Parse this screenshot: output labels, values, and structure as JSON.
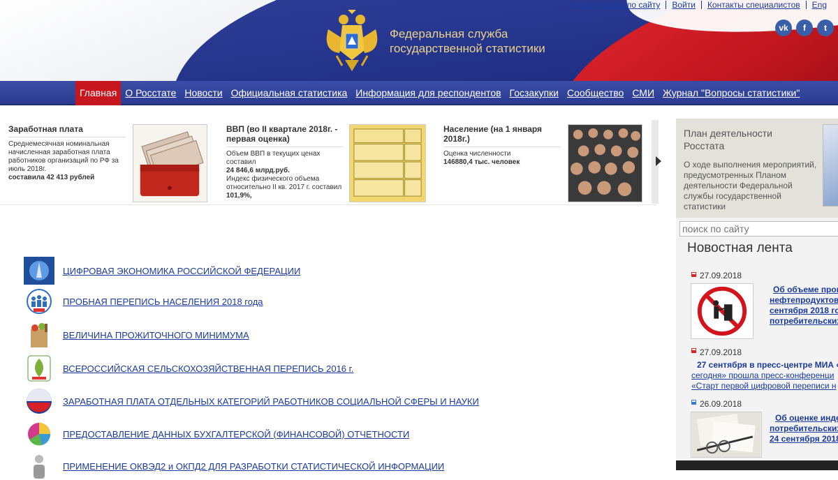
{
  "top_links": [
    "Путеводитель по сайту",
    "Войти",
    "Контакты специалистов",
    "Eng"
  ],
  "socials": [
    "vk",
    "f",
    "t"
  ],
  "logo": {
    "line1": "Федеральная служба",
    "line2": "государственной статистики"
  },
  "nav": [
    "Главная",
    "О Росстате",
    "Новости",
    "Официальная статистика",
    "Информация для респондентов",
    "Госзакупки",
    "Сообщество",
    "СМИ",
    "Журнал \"Вопросы статистики\""
  ],
  "slides": {
    "salary": {
      "title": "Заработная плата",
      "text": "Среднемесячная номинальная начисленная заработная плата работников организаций по РФ за июль 2018г.",
      "value": "составила 42 413 рублей"
    },
    "gdp": {
      "title": "ВВП (во II квартале 2018г. - первая оценка)",
      "text1": "Объем ВВП в текущих ценах составил",
      "value1": "24 846,6 млрд.руб.",
      "text2": "Индекс физического объема относительно II кв. 2017 г. составил",
      "value2": "101,9%,"
    },
    "population": {
      "title": "Население (на 1 января 2018г.)",
      "text": "Оценка численности",
      "value": "146880,4 тыс. человек"
    }
  },
  "plan": {
    "title": "План деятельности Росстата",
    "text": "О ходе выполнения мероприятий, предусмотренных Планом деятельности Федеральной службы государственной статистики"
  },
  "search": {
    "placeholder": "поиск по сайту"
  },
  "news": {
    "title": "Новостная лента",
    "items": [
      {
        "date": "27.09.2018",
        "lines": [
          "Об объеме прои",
          "нефтепродуктов",
          "сентября 2018 го",
          "потребительских"
        ]
      },
      {
        "date": "27.09.2018",
        "lines": [
          "27 сентября  в пресс-центре МИА «",
          "сегодня» прошла пресс-конференци",
          "«Старт первой цифровой переписи н"
        ]
      },
      {
        "date": "26.09.2018",
        "lines": [
          "Об оценке инде",
          "потребительских",
          "24 сентября 2018"
        ]
      }
    ]
  },
  "links": [
    "ЦИФРОВАЯ ЭКОНОМИКА РОССИЙСКОЙ ФЕДЕРАЦИИ",
    "ПРОБНАЯ ПЕРЕПИСЬ НАСЕЛЕНИЯ 2018 года",
    "ВЕЛИЧИНА ПРОЖИТОЧНОГО МИНИМУМА",
    "ВСЕРОССИЙСКАЯ СЕЛЬСКОХОЗЯЙСТВЕННАЯ ПЕРЕПИСЬ 2016 г.",
    "ЗАРАБОТНАЯ ПЛАТА ОТДЕЛЬНЫХ КАТЕГОРИЙ РАБОТНИКОВ СОЦИАЛЬНОЙ СФЕРЫ И НАУКИ",
    "ПРЕДОСТАВЛЕНИЕ ДАННЫХ БУХГАЛТЕРСКОЙ (ФИНАНСОВОЙ) ОТЧЕТНОСТИ",
    "ПРИМЕНЕНИЕ ОКВЭД2 и ОКПД2 ДЛЯ РАЗРАБОТКИ СТАТИСТИЧЕСКОЙ ИНФОРМАЦИИ"
  ],
  "icons": {
    "digital": "digital-economy-icon",
    "census": "census-icon",
    "minimum": "grocery-bag-icon",
    "agri": "agri-census-icon",
    "salary": "russia-globe-icon",
    "accounting": "pie-chart-icon",
    "okved": "person-icon"
  }
}
